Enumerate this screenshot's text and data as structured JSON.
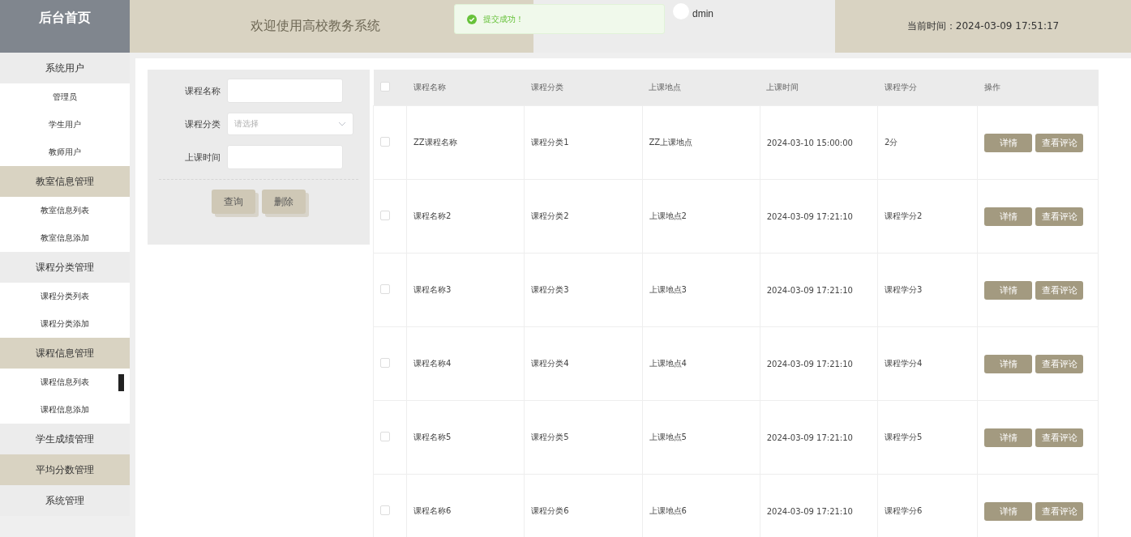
{
  "header": {
    "brand": "后台首页",
    "welcome": "欢迎使用高校教务系统",
    "user": "dmin",
    "clock": "当前时间：2024-03-09 17:51:17"
  },
  "toast": {
    "text": "提交成功！"
  },
  "sidebar": {
    "groups": [
      {
        "label": "系统用户",
        "children": [
          {
            "label": "管理员",
            "selected": false
          },
          {
            "label": "学生用户",
            "selected": false
          },
          {
            "label": "教师用户",
            "selected": false
          }
        ]
      },
      {
        "label": "教室信息管理",
        "children": [
          {
            "label": "教室信息列表",
            "selected": false
          },
          {
            "label": "教室信息添加",
            "selected": false
          }
        ]
      },
      {
        "label": "课程分类管理",
        "children": [
          {
            "label": "课程分类列表",
            "selected": false
          },
          {
            "label": "课程分类添加",
            "selected": false
          }
        ]
      },
      {
        "label": "课程信息管理",
        "children": [
          {
            "label": "课程信息列表",
            "selected": true
          },
          {
            "label": "课程信息添加",
            "selected": false
          }
        ]
      },
      {
        "label": "学生成绩管理"
      },
      {
        "label": "平均分数管理"
      },
      {
        "label": "系统管理"
      }
    ]
  },
  "search": {
    "fields": [
      {
        "label": "课程名称",
        "kind": "text"
      },
      {
        "label": "课程分类",
        "kind": "select",
        "placeholder": "请选择"
      },
      {
        "label": "上课时间",
        "kind": "text"
      }
    ],
    "buttons": [
      "查询",
      "删除"
    ]
  },
  "table": {
    "all_checked": false,
    "columns": [
      "课程名称",
      "课程分类",
      "上课地点",
      "上课时间",
      "课程学分",
      "操作"
    ],
    "rows": [
      {
        "checked": false,
        "cells": [
          "ZZ课程名称",
          "课程分类1",
          "ZZ上课地点",
          "2024-03-10 15:00:00",
          "2分"
        ],
        "actions": [
          "详情",
          "查看评论"
        ]
      },
      {
        "checked": false,
        "cells": [
          "课程名称2",
          "课程分类2",
          "上课地点2",
          "2024-03-09 17:21:10",
          "课程学分2"
        ],
        "actions": [
          "详情",
          "查看评论"
        ]
      },
      {
        "checked": false,
        "cells": [
          "课程名称3",
          "课程分类3",
          "上课地点3",
          "2024-03-09 17:21:10",
          "课程学分3"
        ],
        "actions": [
          "详情",
          "查看评论"
        ]
      },
      {
        "checked": false,
        "cells": [
          "课程名称4",
          "课程分类4",
          "上课地点4",
          "2024-03-09 17:21:10",
          "课程学分4"
        ],
        "actions": [
          "详情",
          "查看评论"
        ]
      },
      {
        "checked": false,
        "cells": [
          "课程名称5",
          "课程分类5",
          "上课地点5",
          "2024-03-09 17:21:10",
          "课程学分5"
        ],
        "actions": [
          "详情",
          "查看评论"
        ]
      },
      {
        "checked": false,
        "cells": [
          "课程名称6",
          "课程分类6",
          "上课地点6",
          "2024-03-09 17:21:10",
          "课程学分6"
        ],
        "actions": [
          "详情",
          "查看评论"
        ]
      }
    ]
  }
}
